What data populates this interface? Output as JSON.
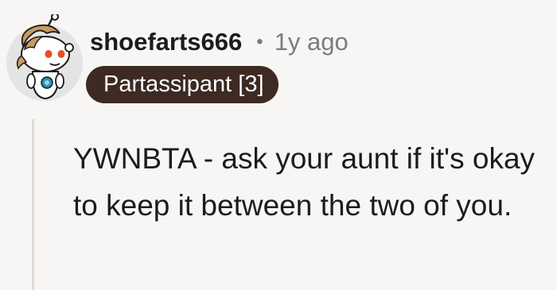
{
  "comment": {
    "author": "shoefarts666",
    "separator": "•",
    "timestamp": "1y ago",
    "flair": "Partassipant [3]",
    "body": "YWNBTA - ask your aunt if it's okay to keep it between the two of you."
  },
  "avatar": {
    "icon": "snoo-avatar-icon",
    "background_color": "#e4e4e4",
    "hair_color": "#c89a62"
  },
  "colors": {
    "page_background": "#f7f6f4",
    "flair_background": "#3d2a22",
    "flair_text": "#ffffff",
    "muted_text": "#7c7c7c",
    "thread_line": "#e0dcd9"
  }
}
